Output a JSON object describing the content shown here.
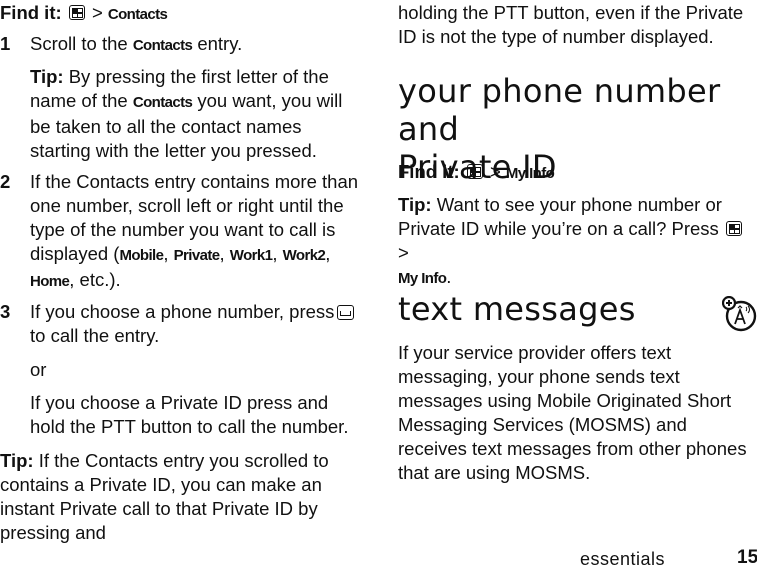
{
  "left_column": {
    "find_it": {
      "label": "Find it:",
      "icon": "menu-key-icon",
      "separator": ">",
      "target": "Contacts"
    },
    "steps": [
      {
        "num": "1",
        "parts": [
          "Scroll to the ",
          "Contacts",
          " entry."
        ],
        "tip": {
          "label": "Tip:",
          "parts": [
            " By pressing the first letter of the name of the ",
            "Contacts",
            " you want, you will be taken to all the contact names starting with the letter you pressed."
          ]
        }
      },
      {
        "num": "2",
        "text_before": "If the Contacts entry contains more than one number, scroll left or right until the type of the number you want to call is displayed (",
        "types": [
          "Mobile",
          "Private",
          "Work1",
          "Work2",
          "Home"
        ],
        "text_after": ", etc.)."
      },
      {
        "num": "3",
        "text": "If you choose a phone number, press",
        "icon": "send-key-icon",
        "text2": "to call the entry.",
        "or": "or",
        "alt": "If you choose a Private ID press and hold the PTT button to call the number."
      }
    ],
    "tip": {
      "label": "Tip:",
      "text": " If the Contacts entry you scrolled to contains a Private ID, you can make an instant Private call to that Private ID by pressing and"
    }
  },
  "right_column": {
    "continued": "holding the PTT button, even if the Private ID is not the type of number displayed.",
    "section1": {
      "title_line1": "your phone number and",
      "title_line2": "Private ID",
      "find_it": {
        "label": "Find it:",
        "icon": "menu-key-icon",
        "separator": ">",
        "target": "My Info"
      },
      "tip": {
        "label": "Tip:",
        "text": " Want to see your phone number or Private ID while you’re on a call? Press",
        "separator": ">",
        "target": "My Info",
        "end": "."
      }
    },
    "section2": {
      "title": "text messages",
      "icon": "network-feature-icon",
      "body": "If your service provider offers text messaging, your phone sends text messages using Mobile Originated Short Messaging Services (MOSMS) and receives text messages from other phones that are using MOSMS."
    }
  },
  "footer": {
    "section": "essentials",
    "page": "15"
  }
}
